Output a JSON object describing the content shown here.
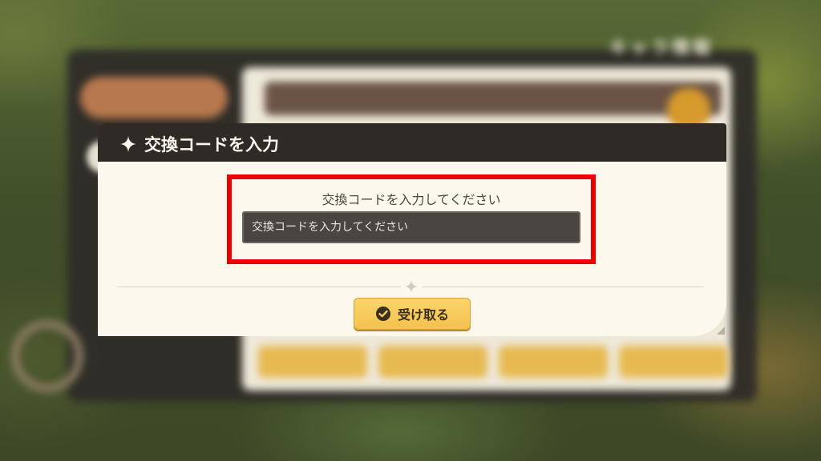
{
  "background_menu": {
    "title": "キャラ情報"
  },
  "dialog": {
    "title": "交換コードを入力",
    "prompt": "交換コードを入力してください",
    "input": {
      "value": "",
      "placeholder": "交換コードを入力してください"
    },
    "receive_button_label": "受け取る"
  },
  "icons": {
    "header": "sparkle-icon",
    "divider": "sparkle-icon",
    "button": "check-circle-icon"
  },
  "colors": {
    "header_bg": "#302a26",
    "body_bg": "#fcf8ee",
    "highlight": "#ee0000",
    "button_bg": "#f3c24f",
    "input_bg": "#4b4541"
  }
}
